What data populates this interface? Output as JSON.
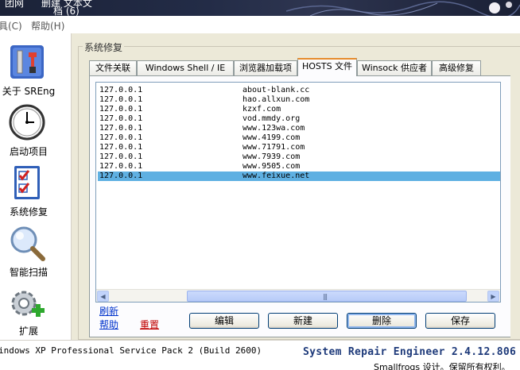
{
  "banner": {
    "item1": "团网",
    "item2": "删建 文本文",
    "item3": "档 (6)"
  },
  "menu": [
    "具(C)",
    "帮助(H)"
  ],
  "sidebar": {
    "items": [
      {
        "label": "关于 SREng",
        "icon": "tools-icon"
      },
      {
        "label": "启动项目",
        "icon": "clock-icon"
      },
      {
        "label": "系统修复",
        "icon": "checklist-icon"
      },
      {
        "label": "智能扫描",
        "icon": "magnifier-icon"
      },
      {
        "label": "扩展",
        "icon": "gear-plus-icon"
      }
    ]
  },
  "group": {
    "title": "系统修复"
  },
  "tabs": [
    {
      "label": "文件关联"
    },
    {
      "label": "Windows Shell / IE"
    },
    {
      "label": "浏览器加载项"
    },
    {
      "label": "HOSTS 文件",
      "active": true
    },
    {
      "label": "Winsock 供应者"
    },
    {
      "label": "高级修复"
    }
  ],
  "hosts": [
    {
      "ip": "127.0.0.1",
      "host": "about-blank.cc"
    },
    {
      "ip": "127.0.0.1",
      "host": "hao.allxun.com"
    },
    {
      "ip": "127.0.0.1",
      "host": "kzxf.com"
    },
    {
      "ip": "127.0.0.1",
      "host": "vod.mmdy.org"
    },
    {
      "ip": "127.0.0.1",
      "host": "www.123wa.com"
    },
    {
      "ip": "127.0.0.1",
      "host": "www.4199.com"
    },
    {
      "ip": "127.0.0.1",
      "host": "www.71791.com"
    },
    {
      "ip": "127.0.0.1",
      "host": "www.7939.com"
    },
    {
      "ip": "127.0.0.1",
      "host": "www.9505.com"
    },
    {
      "ip": "127.0.0.1",
      "host": "www.feixue.net",
      "selected": true
    }
  ],
  "links": {
    "refresh": "刷新",
    "help": "帮助",
    "reset": "重置"
  },
  "buttons": {
    "edit": "编辑",
    "new": "新建",
    "delete": "删除",
    "save": "保存"
  },
  "status": {
    "os": "indows XP Professional Service Pack 2 (Build 2600)",
    "app": "System Repair Engineer 2.4.12.806",
    "copyright": "Smallfrogs 设计。保留所有权利。"
  },
  "colors": {
    "selection": "#5fb0e2",
    "reset_link": "#c00000",
    "link": "#0033cc",
    "version_text": "#1e3a7a"
  }
}
